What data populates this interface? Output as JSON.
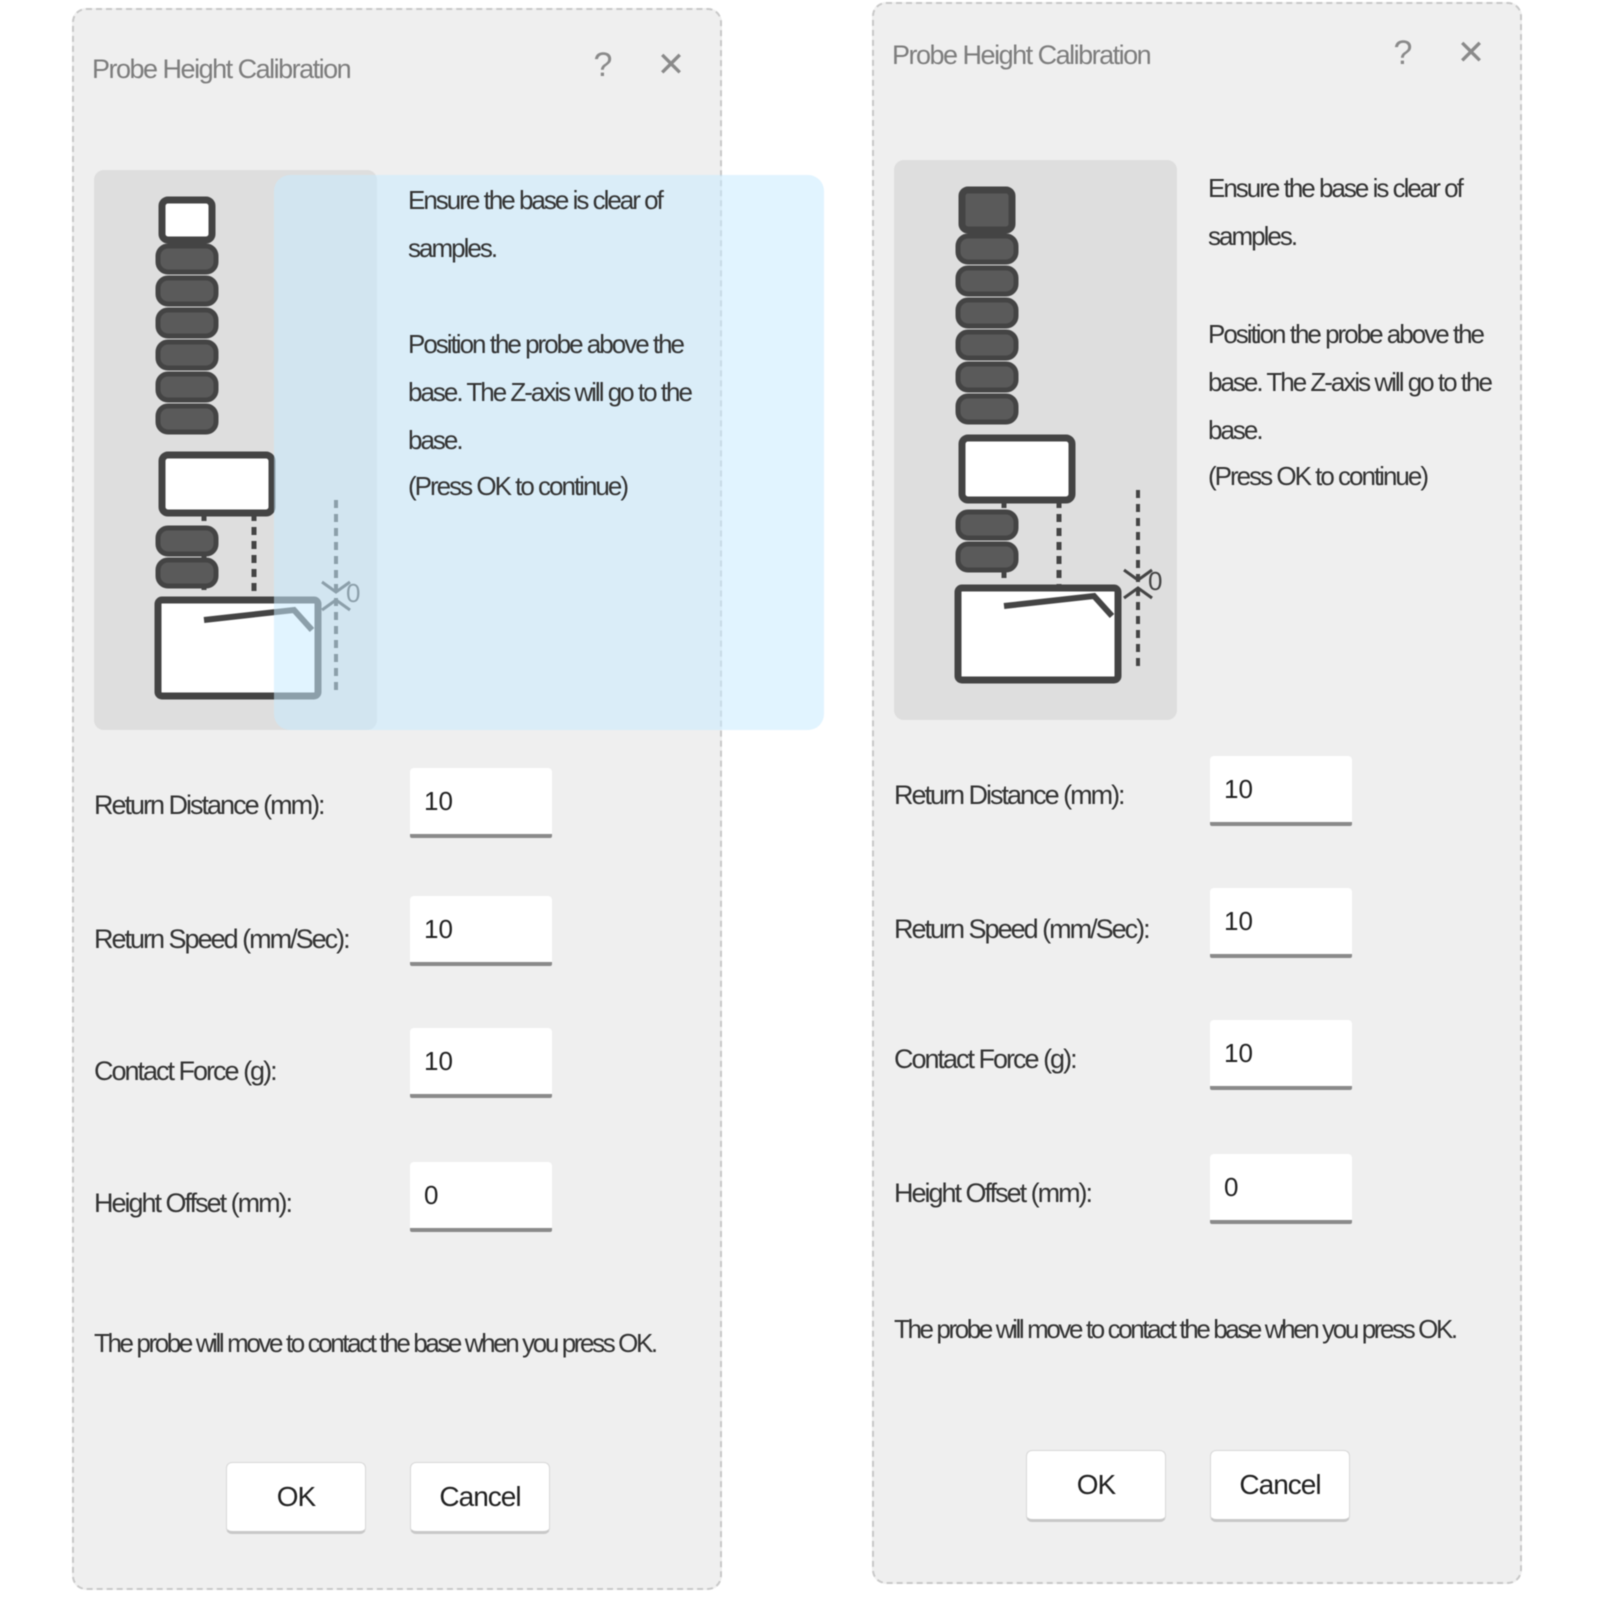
{
  "dialogs": [
    {
      "title": "Probe Height Calibration",
      "help_glyph": "?",
      "close_glyph": "✕",
      "instructions": [
        "Ensure the base is clear of samples.",
        "Position the probe above the base. The Z-axis will go to the base.",
        "(Press OK to continue)"
      ],
      "fields": [
        {
          "label": "Return Distance (mm):",
          "value": "10"
        },
        {
          "label": "Return Speed (mm/Sec):",
          "value": "10"
        },
        {
          "label": "Contact Force (g):",
          "value": "10"
        },
        {
          "label": "Height Offset (mm):",
          "value": "0"
        }
      ],
      "note": "The probe will move to contact the base when you press OK.",
      "ok_label": "OK",
      "cancel_label": "Cancel"
    },
    {
      "title": "Probe Height Calibration",
      "help_glyph": "?",
      "close_glyph": "✕",
      "instructions": [
        "Ensure the base is clear of samples.",
        "Position the probe above the base. The Z-axis will go to the base.",
        "(Press OK to continue)"
      ],
      "fields": [
        {
          "label": "Return Distance (mm):",
          "value": "10"
        },
        {
          "label": "Return Speed (mm/Sec):",
          "value": "10"
        },
        {
          "label": "Contact Force (g):",
          "value": "10"
        },
        {
          "label": "Height Offset (mm):",
          "value": "0"
        }
      ],
      "note": "The probe will move to contact the base when you press OK.",
      "ok_label": "OK",
      "cancel_label": "Cancel"
    }
  ],
  "illustration": {
    "gap_label": "0"
  }
}
